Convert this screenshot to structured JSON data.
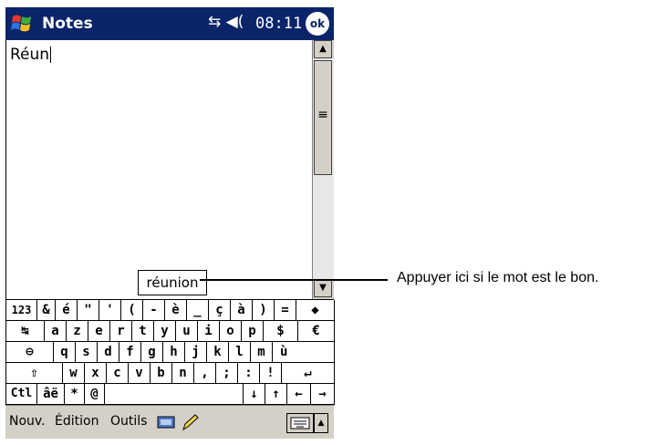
{
  "titlebar": {
    "app_title": "Notes",
    "status_icons": "⇆ ◀(",
    "time": "08:11",
    "ok_label": "ok"
  },
  "note": {
    "text": "Réun"
  },
  "scrollbar": {
    "up": "▲",
    "down": "▼",
    "grip": "≡"
  },
  "suggestion": {
    "word": "réunion"
  },
  "callout": {
    "text": "Appuyer ici si le mot est le bon."
  },
  "keyboard": {
    "rows": [
      [
        "123",
        "&",
        "é",
        "\"",
        "'",
        "(",
        "-",
        "è",
        "_",
        "ç",
        "à",
        ")",
        "=",
        "◆"
      ],
      [
        "↹",
        "a",
        "z",
        "e",
        "r",
        "t",
        "y",
        "u",
        "i",
        "o",
        "p",
        "$",
        "€"
      ],
      [
        "⊖",
        "q",
        "s",
        "d",
        "f",
        "g",
        "h",
        "j",
        "k",
        "l",
        "m",
        "ù"
      ],
      [
        "⇧",
        "w",
        "x",
        "c",
        "v",
        "b",
        "n",
        ",",
        ";",
        ":",
        "!",
        "↵"
      ],
      [
        "Ctl",
        "âë",
        "*",
        "@",
        "",
        "↓",
        "↑",
        "←",
        "→"
      ]
    ]
  },
  "menubar": {
    "new_label": "Nouv.",
    "edit_label": "Édition",
    "tools_label": "Outils",
    "sip_arrow": "▲"
  }
}
